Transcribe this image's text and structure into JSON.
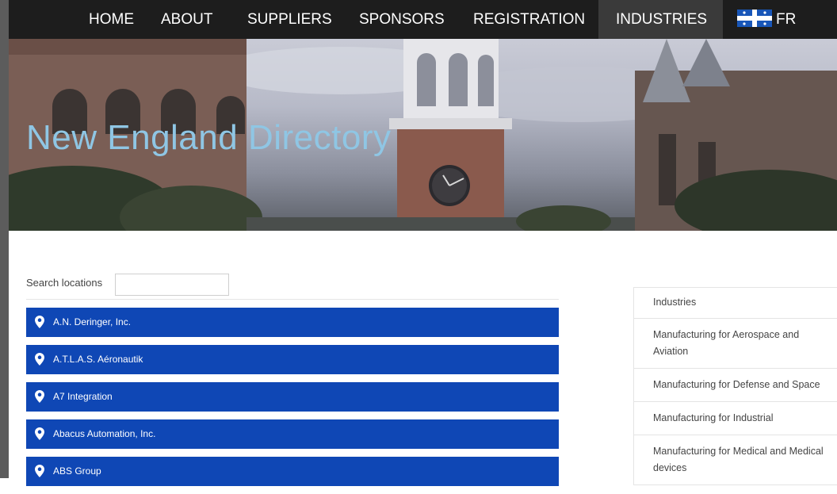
{
  "nav": {
    "items": [
      {
        "label": "HOME"
      },
      {
        "label": "ABOUT"
      },
      {
        "label": "SUPPLIERS"
      },
      {
        "label": "SPONSORS"
      },
      {
        "label": "REGISTRATION"
      },
      {
        "label": "INDUSTRIES",
        "active": true
      }
    ],
    "language": {
      "label": "FR",
      "flag_icon": "quebec-flag-icon"
    }
  },
  "hero": {
    "title": "New England Directory"
  },
  "search": {
    "label": "Search locations",
    "value": "",
    "placeholder": ""
  },
  "locations": [
    {
      "name": "A.N. Deringer, Inc."
    },
    {
      "name": "A.T.L.A.S. Aéronautik"
    },
    {
      "name": "A7 Integration"
    },
    {
      "name": "Abacus Automation, Inc."
    },
    {
      "name": "ABS Group"
    }
  ],
  "sidebar": {
    "header": "Industries",
    "items": [
      "Manufacturing for Aerospace and Aviation",
      "Manufacturing for Defense and Space",
      "Manufacturing for Industrial",
      "Manufacturing for Medical and Medical devices"
    ]
  },
  "colors": {
    "nav_bg": "#1d1d1d",
    "nav_active_bg": "#3a3a3a",
    "location_bar": "#0f47b5",
    "hero_title": "#8fc6e4"
  }
}
